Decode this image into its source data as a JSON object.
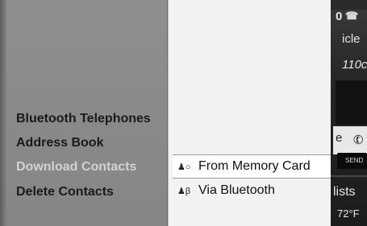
{
  "menu": {
    "items": [
      {
        "label": "Bluetooth Telephones",
        "selected": false
      },
      {
        "label": "Address Book",
        "selected": false
      },
      {
        "label": "Download Contacts",
        "selected": true
      },
      {
        "label": "Delete Contacts",
        "selected": false
      }
    ]
  },
  "submenu": {
    "items": [
      {
        "label": "From Memory Card",
        "icon": "memory-card-contacts-icon"
      },
      {
        "label": "Via Bluetooth",
        "icon": "bluetooth-contacts-icon"
      }
    ]
  },
  "background": {
    "status": "0",
    "vehicle_label": "icle",
    "number_label": "110c",
    "send_label": "SEND",
    "lists_label": "lists",
    "temp_label": "72°F",
    "partial_letter": "e"
  }
}
